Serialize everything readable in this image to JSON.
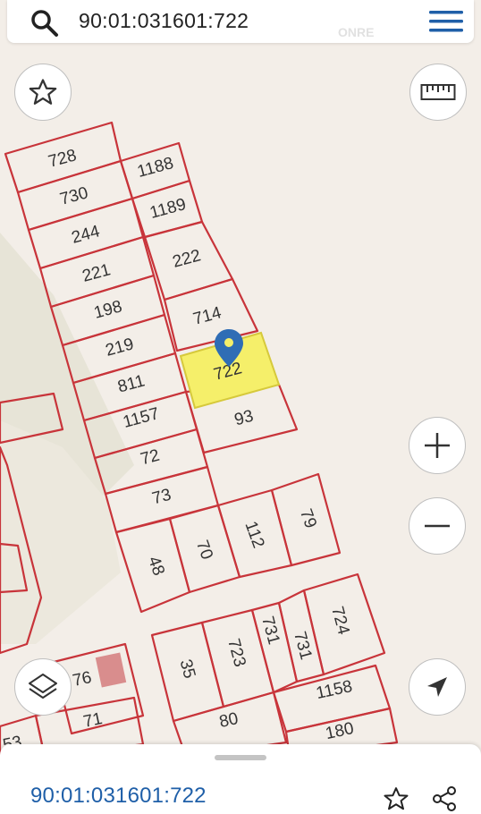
{
  "search": {
    "query": "90:01:031601:722"
  },
  "watermark": "ONRE",
  "parcels": {
    "p728": "728",
    "p730": "730",
    "p244": "244",
    "p221": "221",
    "p198": "198",
    "p219": "219",
    "p811": "811",
    "p1157": "1157",
    "p72": "72",
    "p73": "73",
    "p48": "48",
    "p70": "70",
    "p112": "112",
    "p79": "79",
    "p1188": "1188",
    "p1189": "1189",
    "p222": "222",
    "p714": "714",
    "p722": "722",
    "p93": "93",
    "p35": "35",
    "p723": "723",
    "p731a": "731",
    "p731b": "731",
    "p724": "724",
    "p1158": "1158",
    "p80": "80",
    "p180": "180",
    "p76": "76",
    "p71": "71",
    "p53": "53"
  },
  "selected": {
    "cadastral_number": "90:01:031601:722",
    "highlight_color": "#f5ef6a"
  },
  "colors": {
    "boundary": "#c8343a",
    "pin": "#2f6db5",
    "accent": "#1f5fa8"
  },
  "icons": [
    "search-icon",
    "menu-icon",
    "star-icon",
    "ruler-icon",
    "zoom-in-icon",
    "zoom-out-icon",
    "layers-icon",
    "location-arrow-icon",
    "share-icon",
    "map-pin-icon"
  ]
}
